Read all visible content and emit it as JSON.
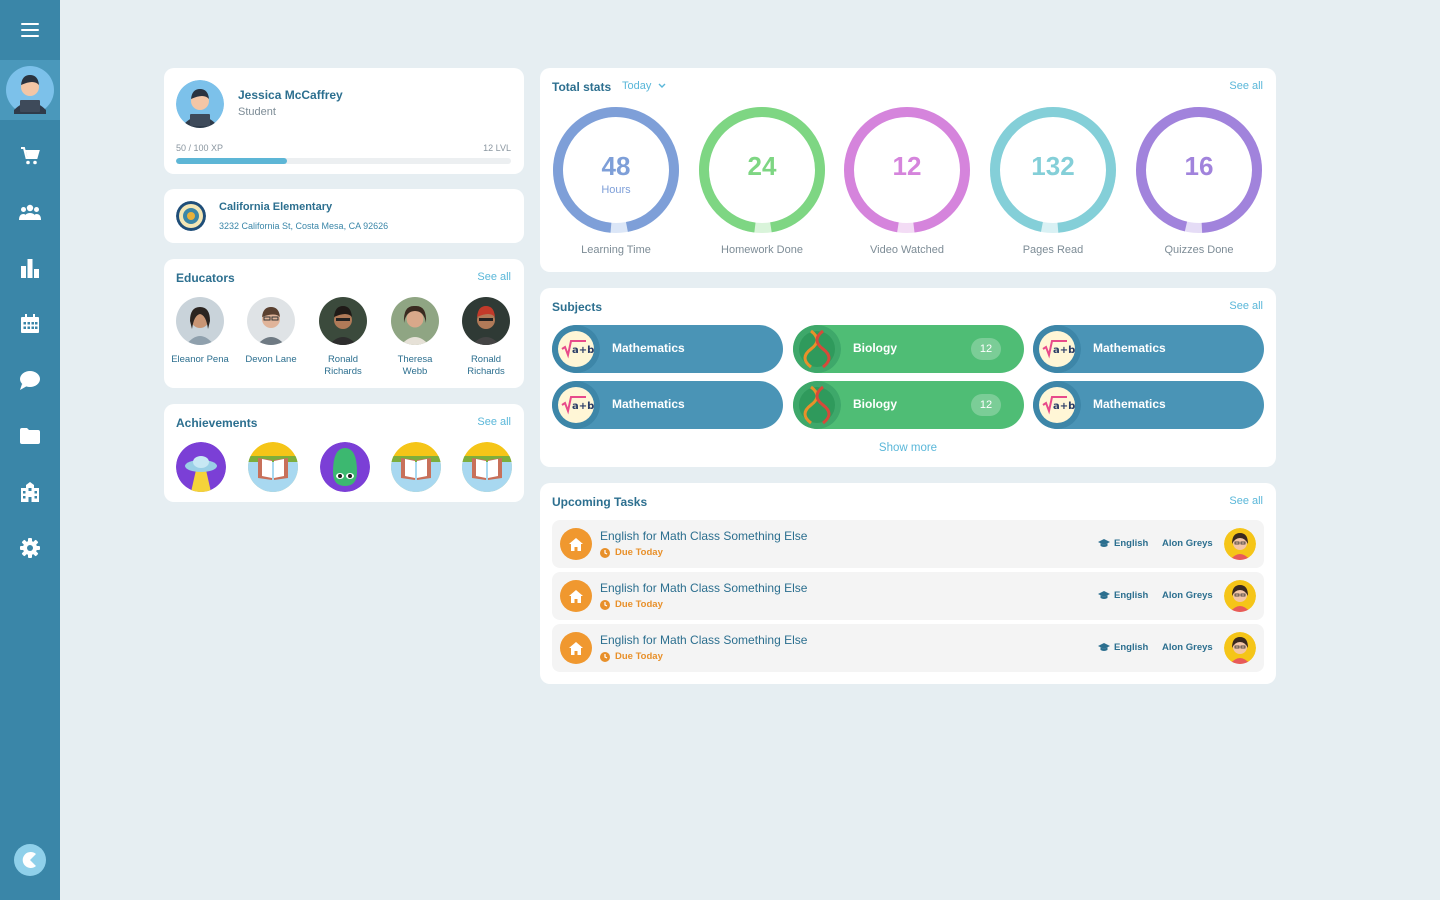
{
  "profile": {
    "name": "Jessica McCaffrey",
    "role": "Student",
    "xp": "50 / 100 XP",
    "level": "12 LVL",
    "xp_progress": 0.33
  },
  "school": {
    "name": "California Elementary",
    "address": "3232 California St, Costa Mesa, CA 92626"
  },
  "educators": {
    "title": "Educators",
    "see_all": "See all",
    "items": [
      {
        "name": "Eleanor Pena"
      },
      {
        "name": "Devon Lane"
      },
      {
        "name": "Ronald Richards"
      },
      {
        "name": "Theresa Webb"
      },
      {
        "name": "Ronald Richards"
      }
    ]
  },
  "achievements": {
    "title": "Achievements",
    "see_all": "See all"
  },
  "stats": {
    "title": "Total stats",
    "period": "Today",
    "see_all": "See all",
    "items": [
      {
        "value": "48",
        "unit": "Hours",
        "label": "Learning Time",
        "color": "#7e9fd8",
        "light": "#dbe6f7"
      },
      {
        "value": "24",
        "unit": "",
        "label": "Homework Done",
        "color": "#7ed683",
        "light": "#d9f4da"
      },
      {
        "value": "12",
        "unit": "",
        "label": "Video Watched",
        "color": "#d584dc",
        "light": "#f3dcf5"
      },
      {
        "value": "132",
        "unit": "",
        "label": "Pages Read",
        "color": "#84cfd8",
        "light": "#d9f1f4"
      },
      {
        "value": "16",
        "unit": "",
        "label": "Quizzes Done",
        "color": "#a183dc",
        "light": "#e5dcf6"
      }
    ]
  },
  "subjects": {
    "title": "Subjects",
    "see_all": "See all",
    "show_more": "Show more",
    "items": [
      {
        "name": "Mathematics",
        "kind": "math",
        "count": ""
      },
      {
        "name": "Biology",
        "kind": "bio",
        "count": "12"
      },
      {
        "name": "Mathematics",
        "kind": "math",
        "count": ""
      },
      {
        "name": "Mathematics",
        "kind": "math",
        "count": ""
      },
      {
        "name": "Biology",
        "kind": "bio",
        "count": "12"
      },
      {
        "name": "Mathematics",
        "kind": "math",
        "count": ""
      }
    ]
  },
  "tasks": {
    "title": "Upcoming Tasks",
    "see_all": "See all",
    "items": [
      {
        "title": "English for Math Class Something Else",
        "due": "Due Today",
        "subject": "English",
        "teacher": "Alon Greys"
      },
      {
        "title": "English for Math Class Something Else",
        "due": "Due Today",
        "subject": "English",
        "teacher": "Alon Greys"
      },
      {
        "title": "English for Math Class Something Else",
        "due": "Due Today",
        "subject": "English",
        "teacher": "Alon Greys"
      }
    ]
  }
}
